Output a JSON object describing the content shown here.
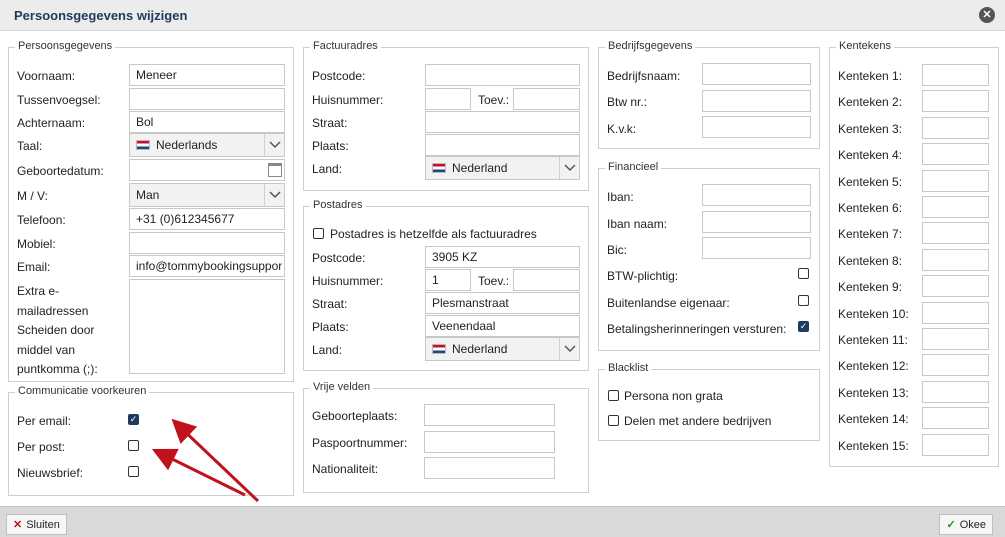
{
  "window": {
    "title": "Persoonsgegevens wijzigen",
    "close_icon": "close-icon"
  },
  "persoonsgegevens": {
    "legend": "Persoonsgegevens",
    "voornaam_label": "Voornaam:",
    "voornaam": "Meneer",
    "tussenvoegsel_label": "Tussenvoegsel:",
    "tussenvoegsel": "",
    "achternaam_label": "Achternaam:",
    "achternaam": "Bol",
    "taal_label": "Taal:",
    "taal": "Nederlands",
    "geboortedatum_label": "Geboortedatum:",
    "geboortedatum": "",
    "mv_label": "M / V:",
    "mv": "Man",
    "telefoon_label": "Telefoon:",
    "telefoon": "+31 (0)612345677",
    "mobiel_label": "Mobiel:",
    "mobiel": "",
    "email_label": "Email:",
    "email": "info@tommybookingsuppor",
    "extra_label": "Extra e-mailadressen Scheiden door middel van puntkomma (;):",
    "extra": ""
  },
  "communicatie": {
    "legend": "Communicatie voorkeuren",
    "per_email_label": "Per email:",
    "per_email": true,
    "per_post_label": "Per post:",
    "per_post": false,
    "nieuwsbrief_label": "Nieuwsbrief:",
    "nieuwsbrief": false
  },
  "factuuradres": {
    "legend": "Factuuradres",
    "postcode_label": "Postcode:",
    "postcode": "",
    "huisnummer_label": "Huisnummer:",
    "huisnummer": "",
    "toev_label": "Toev.:",
    "toev": "",
    "straat_label": "Straat:",
    "straat": "",
    "plaats_label": "Plaats:",
    "plaats": "",
    "land_label": "Land:",
    "land": "Nederland"
  },
  "postadres": {
    "legend": "Postadres",
    "same_label": "Postadres is hetzelfde als factuuradres",
    "same": false,
    "postcode_label": "Postcode:",
    "postcode": "3905 KZ",
    "huisnummer_label": "Huisnummer:",
    "huisnummer": "1",
    "toev_label": "Toev.:",
    "toev": "",
    "straat_label": "Straat:",
    "straat": "Plesmanstraat",
    "plaats_label": "Plaats:",
    "plaats": "Veenendaal",
    "land_label": "Land:",
    "land": "Nederland"
  },
  "vrije_velden": {
    "legend": "Vrije velden",
    "geboorteplaats_label": "Geboorteplaats:",
    "geboorteplaats": "",
    "paspoortnummer_label": "Paspoortnummer:",
    "paspoortnummer": "",
    "nationaliteit_label": "Nationaliteit:",
    "nationaliteit": ""
  },
  "bedrijf": {
    "legend": "Bedrijfsgegevens",
    "naam_label": "Bedrijfsnaam:",
    "naam": "",
    "btw_label": "Btw nr.:",
    "btw": "",
    "kvk_label": "K.v.k:",
    "kvk": ""
  },
  "financieel": {
    "legend": "Financieel",
    "iban_label": "Iban:",
    "iban": "",
    "iban_naam_label": "Iban naam:",
    "iban_naam": "",
    "bic_label": "Bic:",
    "bic": "",
    "btw_plichtig_label": "BTW-plichtig:",
    "btw_plichtig": false,
    "buitenlandse_label": "Buitenlandse eigenaar:",
    "buitenlandse": false,
    "herinneringen_label": "Betalingsherinneringen versturen:",
    "herinneringen": true
  },
  "blacklist": {
    "legend": "Blacklist",
    "non_grata_label": "Persona non grata",
    "non_grata": false,
    "delen_label": "Delen met andere bedrijven",
    "delen": false
  },
  "kentekens": {
    "legend": "Kentekens",
    "items": [
      {
        "label": "Kenteken 1:",
        "value": ""
      },
      {
        "label": "Kenteken 2:",
        "value": ""
      },
      {
        "label": "Kenteken 3:",
        "value": ""
      },
      {
        "label": "Kenteken 4:",
        "value": ""
      },
      {
        "label": "Kenteken 5:",
        "value": ""
      },
      {
        "label": "Kenteken 6:",
        "value": ""
      },
      {
        "label": "Kenteken 7:",
        "value": ""
      },
      {
        "label": "Kenteken 8:",
        "value": ""
      },
      {
        "label": "Kenteken 9:",
        "value": ""
      },
      {
        "label": "Kenteken 10:",
        "value": ""
      },
      {
        "label": "Kenteken 11:",
        "value": ""
      },
      {
        "label": "Kenteken 12:",
        "value": ""
      },
      {
        "label": "Kenteken 13:",
        "value": ""
      },
      {
        "label": "Kenteken 14:",
        "value": ""
      },
      {
        "label": "Kenteken 15:",
        "value": ""
      }
    ]
  },
  "footer": {
    "sluiten": "Sluiten",
    "okee": "Okee"
  },
  "colors": {
    "accent": "#1f3a5c",
    "arrow": "#c0121d"
  }
}
